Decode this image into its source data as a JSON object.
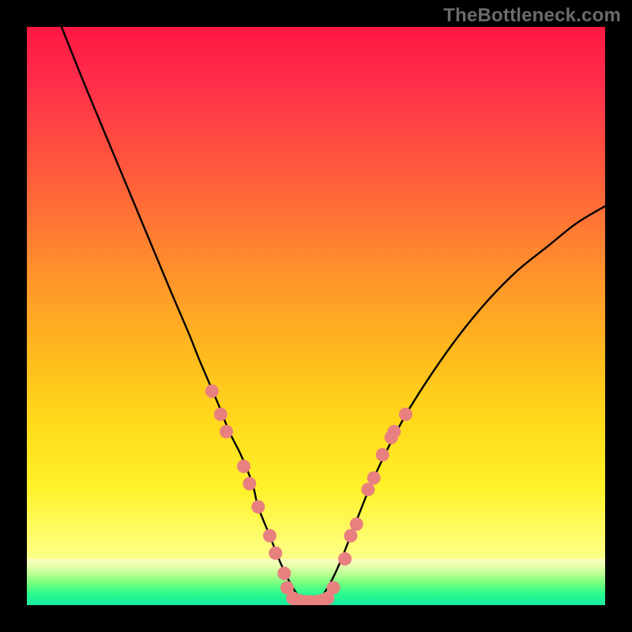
{
  "watermark": "TheBottleneck.com",
  "chart_data": {
    "type": "line",
    "title": "",
    "xlabel": "",
    "ylabel": "",
    "xlim": [
      0,
      100
    ],
    "ylim": [
      0,
      100
    ],
    "series": [
      {
        "name": "curve",
        "x": [
          6,
          10,
          15,
          20,
          25,
          28,
          30,
          33,
          35,
          37,
          39,
          40,
          42,
          44,
          46,
          48,
          50,
          52,
          54,
          56,
          60,
          65,
          70,
          75,
          80,
          85,
          90,
          95,
          100
        ],
        "y": [
          100,
          90,
          78,
          66,
          54,
          47,
          42,
          35,
          30,
          26,
          21,
          17,
          12,
          7,
          3,
          0.5,
          0.5,
          3,
          7,
          12,
          22,
          32,
          40,
          47,
          53,
          58,
          62,
          66,
          69
        ]
      }
    ],
    "markers": {
      "name": "dots",
      "color": "#e98080",
      "points": [
        {
          "x": 32,
          "y": 37
        },
        {
          "x": 33.5,
          "y": 33
        },
        {
          "x": 34.5,
          "y": 30
        },
        {
          "x": 37.5,
          "y": 24
        },
        {
          "x": 38.5,
          "y": 21
        },
        {
          "x": 40,
          "y": 17
        },
        {
          "x": 42,
          "y": 12
        },
        {
          "x": 43,
          "y": 9
        },
        {
          "x": 44.5,
          "y": 5.5
        },
        {
          "x": 45,
          "y": 3
        },
        {
          "x": 46,
          "y": 1.2
        },
        {
          "x": 47,
          "y": 0.8
        },
        {
          "x": 48,
          "y": 0.6
        },
        {
          "x": 49,
          "y": 0.6
        },
        {
          "x": 50,
          "y": 0.6
        },
        {
          "x": 51,
          "y": 0.8
        },
        {
          "x": 52,
          "y": 1.2
        },
        {
          "x": 53,
          "y": 3
        },
        {
          "x": 55,
          "y": 8
        },
        {
          "x": 56,
          "y": 12
        },
        {
          "x": 57,
          "y": 14
        },
        {
          "x": 59,
          "y": 20
        },
        {
          "x": 60,
          "y": 22
        },
        {
          "x": 61.5,
          "y": 26
        },
        {
          "x": 63,
          "y": 29
        },
        {
          "x": 63.5,
          "y": 30
        },
        {
          "x": 65.5,
          "y": 33
        }
      ]
    },
    "green_band": {
      "y0": 0,
      "y1": 8
    }
  }
}
